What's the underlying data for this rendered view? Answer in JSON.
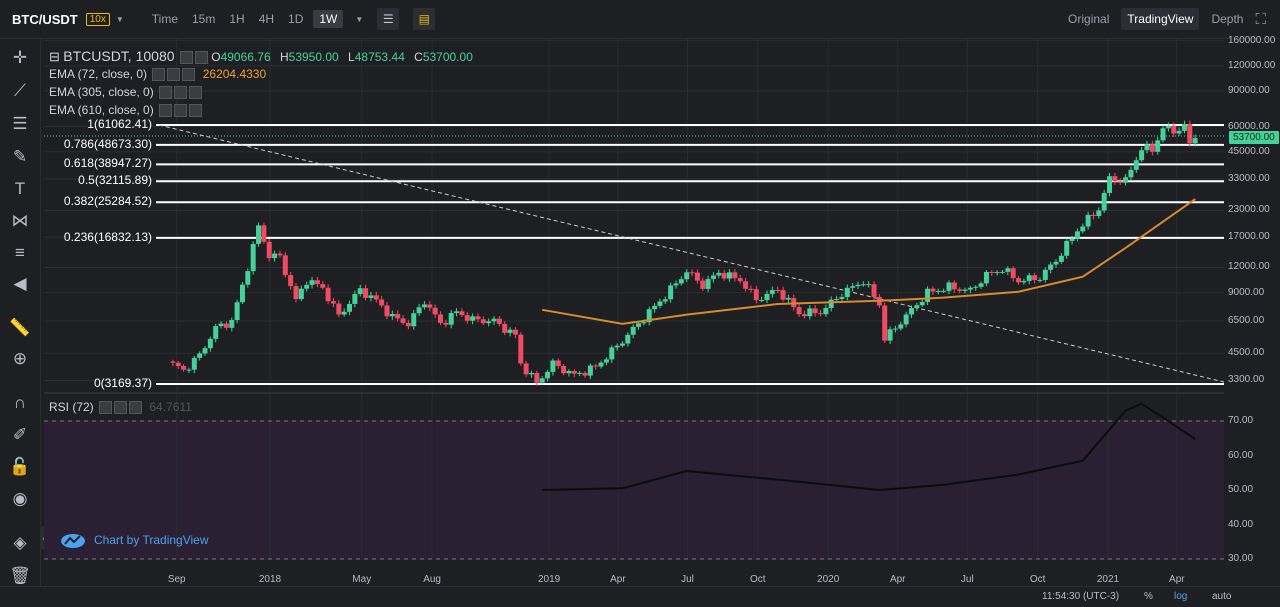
{
  "header": {
    "pair": "BTC/USDT",
    "leverage": "10x",
    "time_label": "Time",
    "intervals": [
      "15m",
      "1H",
      "4H",
      "1D",
      "1W"
    ],
    "active_interval": "1W",
    "modes": [
      "Original",
      "TradingView",
      "Depth"
    ],
    "active_mode": "TradingView"
  },
  "legend": {
    "symbol": "BTCUSDT, 10080",
    "o_label": "O",
    "o": "49066.76",
    "h_label": "H",
    "h": "53950.00",
    "l_label": "L",
    "l": "48753.44",
    "c_label": "C",
    "c": "53700.00",
    "ema1": "EMA (72, close, 0)",
    "ema1_value": "26204.4330",
    "ema2": "EMA (305, close, 0)",
    "ema3": "EMA (610, close, 0)",
    "rsi": "RSI (72)",
    "rsi_value": "64.7611"
  },
  "brand": "Chart by TradingView",
  "footer": {
    "time": "11:54:30 (UTC-3)",
    "pct": "%",
    "log": "log",
    "auto": "auto"
  },
  "colors": {
    "up": "#45d29a",
    "down": "#f04b63",
    "ema": "#d98a2e",
    "rsi_bg": "#2a1f33",
    "fib": "#ffffff"
  },
  "chart_data": {
    "type": "candlestick",
    "log_scale": true,
    "price_ticks": [
      "160000.00",
      "120000.00",
      "90000.00",
      "60000.00",
      "45000.00",
      "33000.00",
      "23000.00",
      "17000.00",
      "12000.00",
      "9000.00",
      "6500.00",
      "4500.00",
      "3300.00"
    ],
    "x_ticks": [
      "Sep",
      "2018",
      "May",
      "Aug",
      "2019",
      "Apr",
      "Jul",
      "Oct",
      "2020",
      "Apr",
      "Jul",
      "Oct",
      "2021",
      "Apr"
    ],
    "last_price": "53700.00",
    "fib_levels": [
      {
        "label": "1(61062.41)",
        "value": 61062.41
      },
      {
        "label": "0.786(48673.30)",
        "value": 48673.3
      },
      {
        "label": "0.618(38947.27)",
        "value": 38947.27
      },
      {
        "label": "0.5(32115.89)",
        "value": 32115.89
      },
      {
        "label": "0.382(25284.52)",
        "value": 25284.52
      },
      {
        "label": "0.236(16832.13)",
        "value": 16832.13
      },
      {
        "label": "0(3169.37)",
        "value": 3169.37
      }
    ],
    "close_path": [
      [
        "2017-08-20",
        4100
      ],
      [
        "2017-09-10",
        3700
      ],
      [
        "2017-10-01",
        4400
      ],
      [
        "2017-10-22",
        6000
      ],
      [
        "2017-11-12",
        6500
      ],
      [
        "2017-11-26",
        9700
      ],
      [
        "2017-12-17",
        19100
      ],
      [
        "2017-12-31",
        13800
      ],
      [
        "2018-01-14",
        13500
      ],
      [
        "2018-02-04",
        8200
      ],
      [
        "2018-02-18",
        10400
      ],
      [
        "2018-03-11",
        9500
      ],
      [
        "2018-04-01",
        6900
      ],
      [
        "2018-04-29",
        9300
      ],
      [
        "2018-05-20",
        8200
      ],
      [
        "2018-06-10",
        6800
      ],
      [
        "2018-07-01",
        6300
      ],
      [
        "2018-07-22",
        8200
      ],
      [
        "2018-08-12",
        6300
      ],
      [
        "2018-09-02",
        7200
      ],
      [
        "2018-09-23",
        6600
      ],
      [
        "2018-10-21",
        6500
      ],
      [
        "2018-11-18",
        5500
      ],
      [
        "2018-11-25",
        4000
      ],
      [
        "2018-12-16",
        3200
      ],
      [
        "2019-01-06",
        4000
      ],
      [
        "2019-02-03",
        3500
      ],
      [
        "2019-03-03",
        3850
      ],
      [
        "2019-04-07",
        5200
      ],
      [
        "2019-05-12",
        7200
      ],
      [
        "2019-06-02",
        8700
      ],
      [
        "2019-06-30",
        11500
      ],
      [
        "2019-07-21",
        9800
      ],
      [
        "2019-08-11",
        11300
      ],
      [
        "2019-09-08",
        10400
      ],
      [
        "2019-09-29",
        8300
      ],
      [
        "2019-10-27",
        9300
      ],
      [
        "2019-11-24",
        7100
      ],
      [
        "2019-12-22",
        7200
      ],
      [
        "2020-01-19",
        8900
      ],
      [
        "2020-02-16",
        10300
      ],
      [
        "2020-03-08",
        7900
      ],
      [
        "2020-03-15",
        5300
      ],
      [
        "2020-04-12",
        6900
      ],
      [
        "2020-05-10",
        9000
      ],
      [
        "2020-06-07",
        9600
      ],
      [
        "2020-07-05",
        9200
      ],
      [
        "2020-07-26",
        11000
      ],
      [
        "2020-08-16",
        11800
      ],
      [
        "2020-09-06",
        10300
      ],
      [
        "2020-10-04",
        10700
      ],
      [
        "2020-10-25",
        13000
      ],
      [
        "2020-11-22",
        18400
      ],
      [
        "2020-12-20",
        23500
      ],
      [
        "2021-01-03",
        33000
      ],
      [
        "2021-01-24",
        32300
      ],
      [
        "2021-02-14",
        47000
      ],
      [
        "2021-02-28",
        46000
      ],
      [
        "2021-03-14",
        59000
      ],
      [
        "2021-03-28",
        57000
      ],
      [
        "2021-04-11",
        60000
      ],
      [
        "2021-04-18",
        49000
      ],
      [
        "2021-04-25",
        53700
      ]
    ],
    "ema72_path": [
      [
        "2018-12-23",
        7400
      ],
      [
        "2019-04-07",
        6300
      ],
      [
        "2019-06-30",
        7000
      ],
      [
        "2019-10-27",
        7900
      ],
      [
        "2020-03-08",
        8200
      ],
      [
        "2020-05-31",
        8500
      ],
      [
        "2020-09-06",
        9100
      ],
      [
        "2020-11-29",
        10800
      ],
      [
        "2021-01-24",
        15000
      ],
      [
        "2021-04-25",
        26204.433
      ]
    ],
    "rsi_ticks": [
      "70.00",
      "60.00",
      "50.00",
      "40.00",
      "30.00"
    ],
    "rsi_path": [
      [
        "2018-12-23",
        50
      ],
      [
        "2019-04-07",
        50.5
      ],
      [
        "2019-06-30",
        55.5
      ],
      [
        "2019-10-27",
        53
      ],
      [
        "2020-03-08",
        50
      ],
      [
        "2020-05-31",
        51.5
      ],
      [
        "2020-09-06",
        54.5
      ],
      [
        "2020-11-29",
        58.5
      ],
      [
        "2021-01-24",
        73
      ],
      [
        "2021-02-14",
        75
      ],
      [
        "2021-03-14",
        71
      ],
      [
        "2021-04-25",
        64.7611
      ]
    ]
  }
}
